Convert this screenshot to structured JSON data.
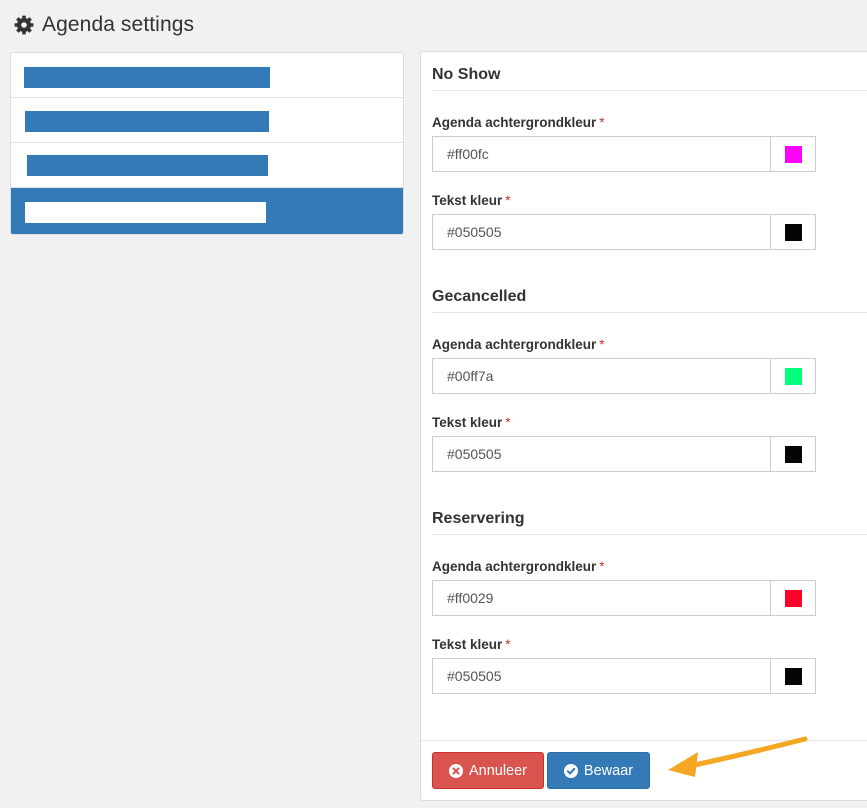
{
  "page": {
    "title": "Agenda settings",
    "icon": "gear-icon"
  },
  "sidebar": {
    "items": [
      {
        "id": "item-1",
        "active": false
      },
      {
        "id": "item-2",
        "active": false
      },
      {
        "id": "item-3",
        "active": false
      },
      {
        "id": "item-4",
        "active": true
      }
    ],
    "accent_color": "#337ab7"
  },
  "sections": [
    {
      "title": "No Show",
      "fields": [
        {
          "label": "Agenda achtergrondkleur",
          "required": "*",
          "value": "#ff00fc",
          "swatch": "#ff00fc"
        },
        {
          "label": "Tekst kleur",
          "required": "*",
          "value": "#050505",
          "swatch": "#050505"
        }
      ]
    },
    {
      "title": "Gecancelled",
      "fields": [
        {
          "label": "Agenda achtergrondkleur",
          "required": "*",
          "value": "#00ff7a",
          "swatch": "#00ff7a"
        },
        {
          "label": "Tekst kleur",
          "required": "*",
          "value": "#050505",
          "swatch": "#050505"
        }
      ]
    },
    {
      "title": "Reservering",
      "fields": [
        {
          "label": "Agenda achtergrondkleur",
          "required": "*",
          "value": "#ff0029",
          "swatch": "#ff0029"
        },
        {
          "label": "Tekst kleur",
          "required": "*",
          "value": "#050505",
          "swatch": "#050505"
        }
      ]
    }
  ],
  "actions": {
    "cancel_label": "Annuleer",
    "cancel_icon": "times-circle-icon",
    "cancel_color": "#d9534f",
    "save_label": "Bewaar",
    "save_icon": "check-circle-icon",
    "save_color": "#337ab7"
  },
  "annotation": {
    "arrow_color": "#f5a623",
    "icon": "arrow-icon"
  }
}
